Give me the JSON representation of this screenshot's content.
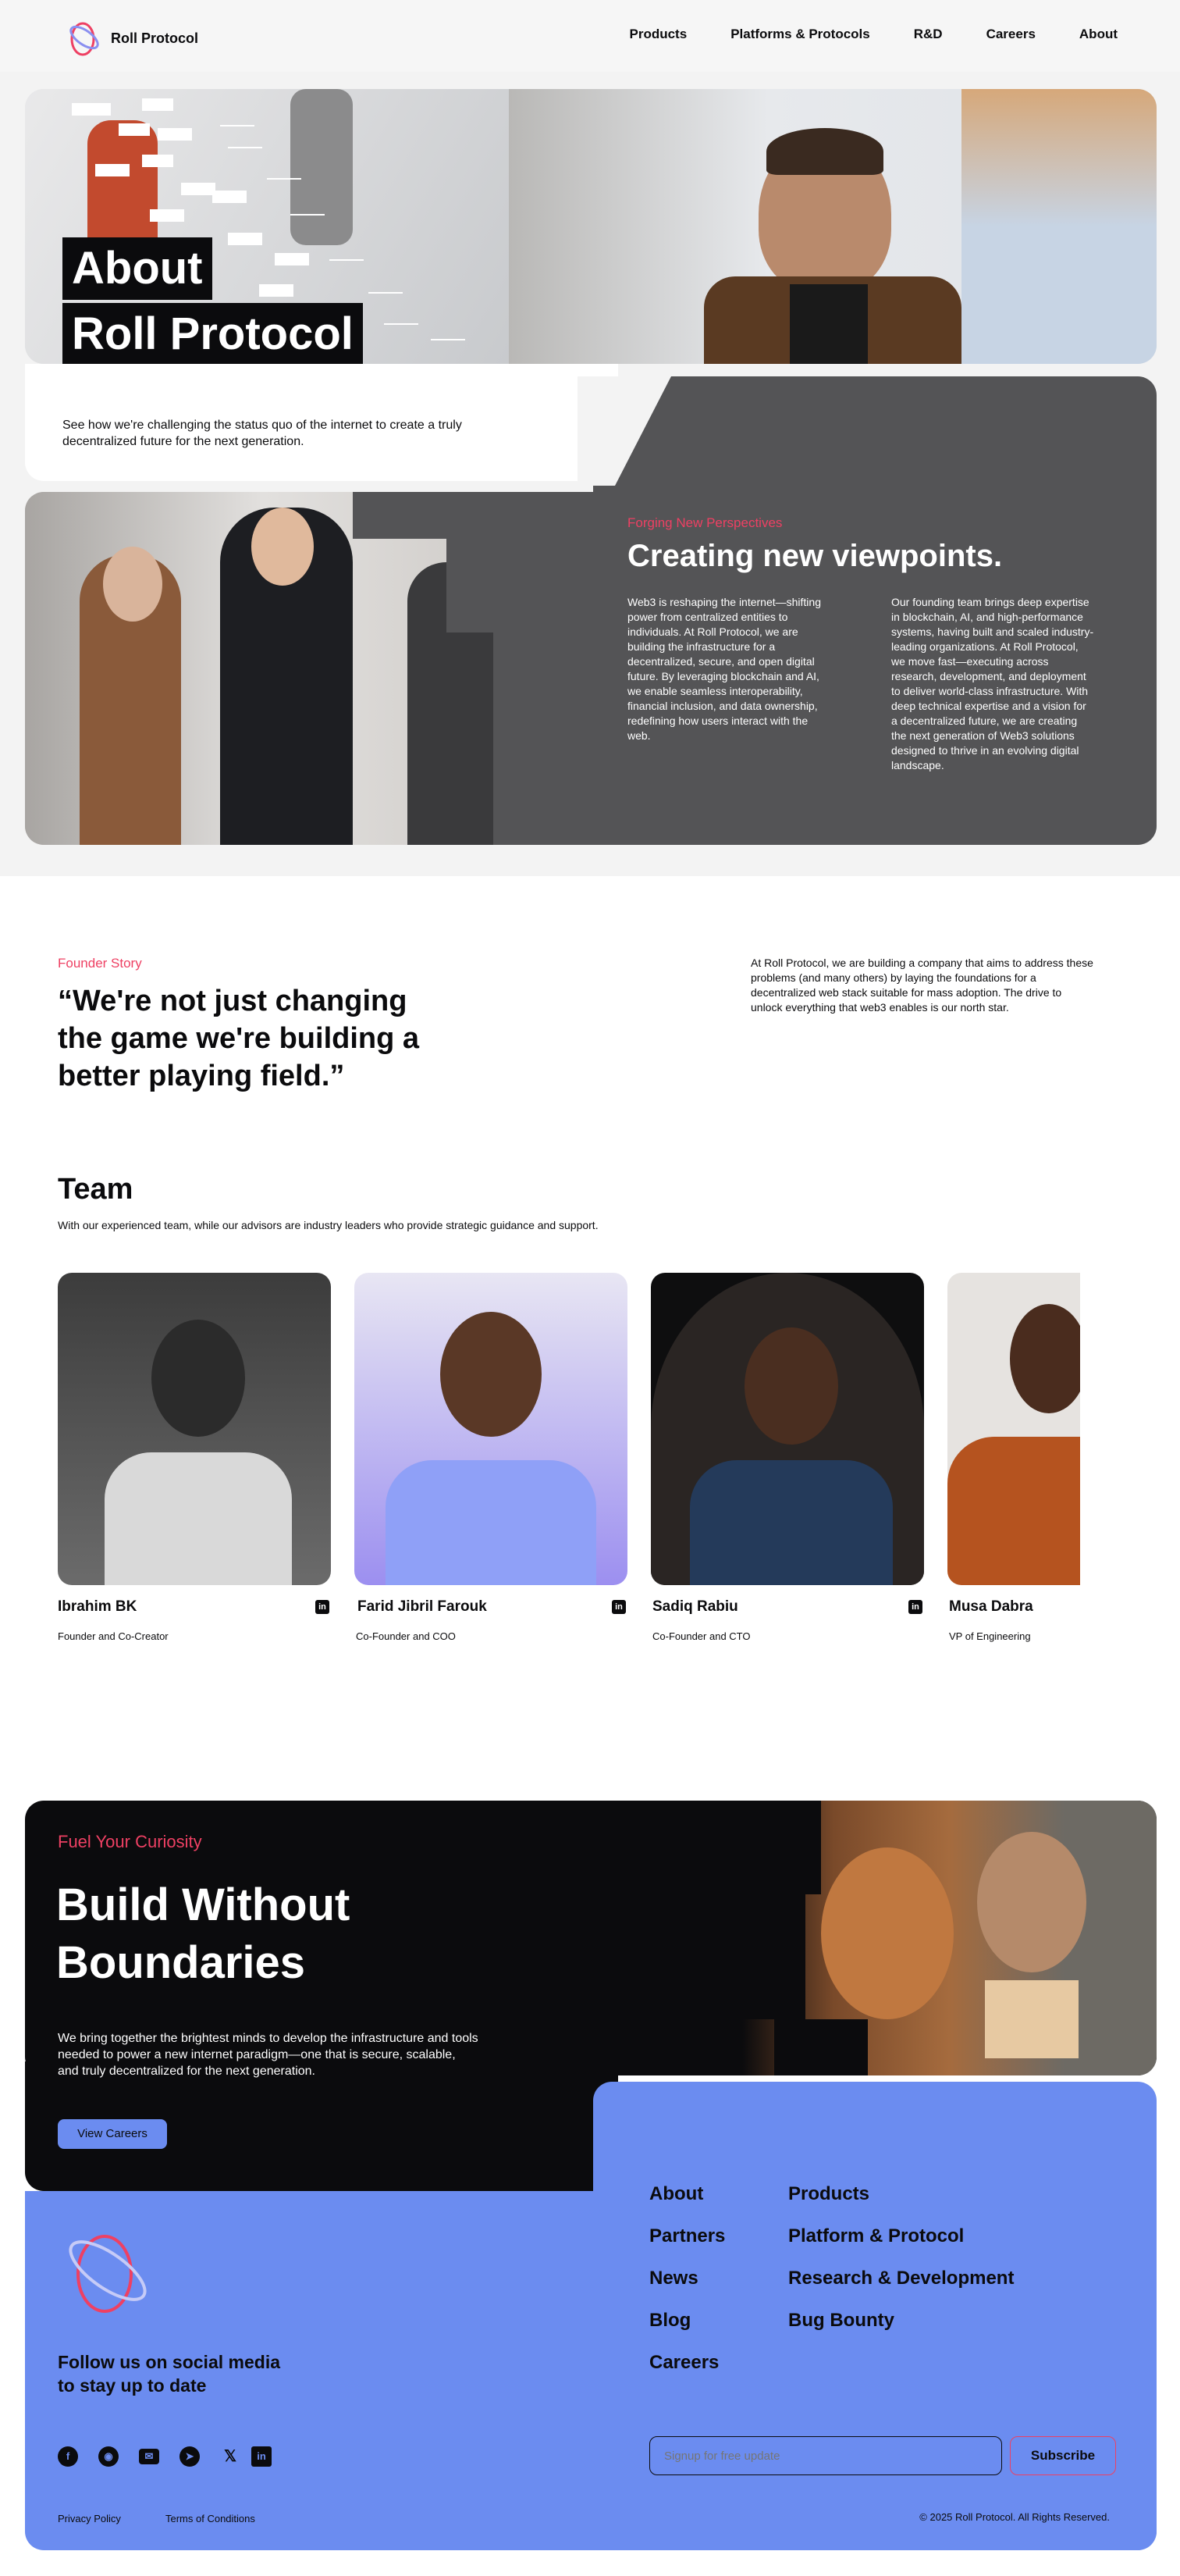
{
  "nav": {
    "brand": "Roll Protocol",
    "links": [
      "Products",
      "Platforms & Protocols",
      "R&D",
      "Careers",
      "About"
    ]
  },
  "hero": {
    "title_line1": "About",
    "title_line2": "Roll Protocol",
    "subtitle": "See how we're challenging the status quo of the internet to create a truly decentralized future for the next generation."
  },
  "perspectives": {
    "eyebrow": "Forging New Perspectives",
    "heading": "Creating new viewpoints.",
    "col1": "Web3 is reshaping the internet—shifting power from centralized entities to individuals. At Roll Protocol, we are building the infrastructure for a decentralized, secure, and open digital future. By leveraging blockchain and AI, we enable seamless interoperability, financial inclusion, and data ownership, redefining how users interact with the web.",
    "col2": "Our founding team brings deep expertise in blockchain, AI, and high-performance systems, having built and scaled industry-leading organizations. At Roll Protocol, we move fast—executing across research, development, and deployment to deliver world-class infrastructure. With deep technical expertise and a vision for a decentralized future, we are creating the next generation of Web3 solutions designed to thrive in an evolving digital landscape."
  },
  "founder": {
    "eyebrow": "Founder Story",
    "quote": "“We're not just changing the game we're building a better playing field.”",
    "body": "At Roll Protocol, we are building a company that aims to address these problems (and many others) by laying the foundations for a decentralized web stack suitable for mass adoption. The drive to unlock everything that web3 enables is our north star."
  },
  "team": {
    "heading": "Team",
    "subtitle": "With our experienced team, while our advisors are industry leaders who provide strategic guidance and support.",
    "members": [
      {
        "name": "Ibrahim BK",
        "role": "Founder and Co-Creator"
      },
      {
        "name": "Farid Jibril Farouk",
        "role": "Co-Founder and COO"
      },
      {
        "name": "Sadiq Rabiu",
        "role": "Co-Founder and CTO"
      },
      {
        "name": "Musa Dabra",
        "role": "VP of Engineering"
      }
    ]
  },
  "cta": {
    "eyebrow": "Fuel Your Curiosity",
    "title_line1": "Build Without",
    "title_line2": "Boundaries",
    "body": "We bring together the brightest minds to develop the infrastructure and tools needed to power a new internet paradigm—one that is secure, scalable, and truly decentralized for the next generation.",
    "button": "View Careers"
  },
  "footer": {
    "col1": [
      "About",
      "Partners",
      "News",
      "Blog",
      "Careers"
    ],
    "col2": [
      "Products",
      "Platform & Protocol",
      "Research & Development",
      "Bug Bounty"
    ],
    "social_text": "Follow us on social media to stay up to date",
    "social_icons": [
      "facebook-icon",
      "github-icon",
      "mail-icon",
      "telegram-icon",
      "x-icon",
      "linkedin-icon"
    ],
    "signup_placeholder": "Signup for free update",
    "subscribe": "Subscribe",
    "privacy": "Privacy Policy",
    "terms": "Terms of Conditions",
    "copyright": "© 2025 Roll Protocol. All Rights Reserved."
  },
  "colors": {
    "accent_blue": "#6b8cf0",
    "dark_gray": "#545456",
    "black": "#0b0b0d",
    "pink": "#ee4063"
  }
}
